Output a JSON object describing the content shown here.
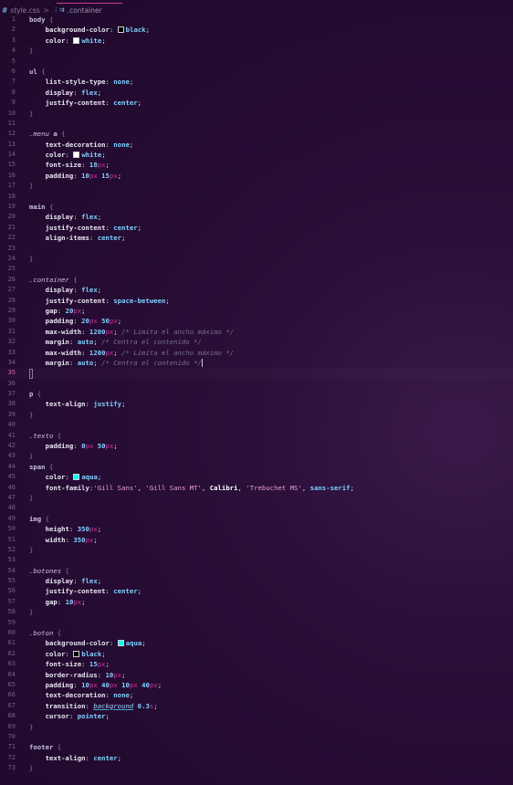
{
  "breadcrumb": {
    "file": "style.css",
    "separator": ">",
    "symbol": ".container"
  },
  "colors": {
    "background": "#240b31",
    "accent": "#d0389a",
    "value": "#7fd0ff",
    "property": "#e9e6f2",
    "comment": "#7a6e8e"
  },
  "lines": [
    {
      "n": "1",
      "t": [
        [
          "sel",
          "body"
        ],
        [
          "br",
          " {"
        ]
      ]
    },
    {
      "n": "2",
      "t": [
        [
          "in",
          "    "
        ],
        [
          "prop",
          "background-color"
        ],
        [
          "p",
          ": "
        ],
        [
          "sw",
          "#000000"
        ],
        [
          "val",
          "black"
        ],
        [
          "p",
          ";"
        ]
      ]
    },
    {
      "n": "3",
      "t": [
        [
          "in",
          "    "
        ],
        [
          "prop",
          "color"
        ],
        [
          "p",
          ": "
        ],
        [
          "sw",
          "#ffffff"
        ],
        [
          "val",
          "white"
        ],
        [
          "p",
          ";"
        ]
      ]
    },
    {
      "n": "4",
      "t": [
        [
          "br",
          "}"
        ]
      ]
    },
    {
      "n": "5",
      "t": []
    },
    {
      "n": "6",
      "t": [
        [
          "sel",
          "ul"
        ],
        [
          "br",
          " {"
        ]
      ]
    },
    {
      "n": "7",
      "t": [
        [
          "in",
          "    "
        ],
        [
          "prop",
          "list-style-type"
        ],
        [
          "p",
          ": "
        ],
        [
          "val",
          "none"
        ],
        [
          "p",
          ";"
        ]
      ]
    },
    {
      "n": "8",
      "t": [
        [
          "in",
          "    "
        ],
        [
          "prop",
          "display"
        ],
        [
          "p",
          ": "
        ],
        [
          "val",
          "flex"
        ],
        [
          "p",
          ";"
        ]
      ]
    },
    {
      "n": "9",
      "t": [
        [
          "in",
          "    "
        ],
        [
          "prop",
          "justify-content"
        ],
        [
          "p",
          ": "
        ],
        [
          "val",
          "center"
        ],
        [
          "p",
          ";"
        ]
      ]
    },
    {
      "n": "10",
      "t": [
        [
          "br",
          "}"
        ]
      ]
    },
    {
      "n": "11",
      "t": []
    },
    {
      "n": "12",
      "t": [
        [
          "seli",
          ".menu"
        ],
        [
          "sel",
          " a"
        ],
        [
          "br",
          " {"
        ]
      ]
    },
    {
      "n": "13",
      "t": [
        [
          "in",
          "    "
        ],
        [
          "prop",
          "text-decoration"
        ],
        [
          "p",
          ": "
        ],
        [
          "val",
          "none"
        ],
        [
          "p",
          ";"
        ]
      ]
    },
    {
      "n": "14",
      "t": [
        [
          "in",
          "    "
        ],
        [
          "prop",
          "color"
        ],
        [
          "p",
          ": "
        ],
        [
          "sw",
          "#ffffff"
        ],
        [
          "val",
          "white"
        ],
        [
          "p",
          ";"
        ]
      ]
    },
    {
      "n": "15",
      "t": [
        [
          "in",
          "    "
        ],
        [
          "prop",
          "font-size"
        ],
        [
          "p",
          ": "
        ],
        [
          "num",
          "18"
        ],
        [
          "unit",
          "px"
        ],
        [
          "p",
          ";"
        ]
      ]
    },
    {
      "n": "16",
      "t": [
        [
          "in",
          "    "
        ],
        [
          "prop",
          "padding"
        ],
        [
          "p",
          ": "
        ],
        [
          "num",
          "10"
        ],
        [
          "unit",
          "px"
        ],
        [
          "p",
          " "
        ],
        [
          "num",
          "15"
        ],
        [
          "unit",
          "px"
        ],
        [
          "p",
          ";"
        ]
      ]
    },
    {
      "n": "17",
      "t": [
        [
          "br",
          "}"
        ]
      ]
    },
    {
      "n": "18",
      "t": []
    },
    {
      "n": "19",
      "t": [
        [
          "sel",
          "main"
        ],
        [
          "br",
          " {"
        ]
      ]
    },
    {
      "n": "20",
      "t": [
        [
          "in",
          "    "
        ],
        [
          "prop",
          "display"
        ],
        [
          "p",
          ": "
        ],
        [
          "val",
          "flex"
        ],
        [
          "p",
          ";"
        ]
      ]
    },
    {
      "n": "21",
      "t": [
        [
          "in",
          "    "
        ],
        [
          "prop",
          "justify-content"
        ],
        [
          "p",
          ": "
        ],
        [
          "val",
          "center"
        ],
        [
          "p",
          ";"
        ]
      ]
    },
    {
      "n": "22",
      "t": [
        [
          "in",
          "    "
        ],
        [
          "prop",
          "align-items"
        ],
        [
          "p",
          ": "
        ],
        [
          "val",
          "center"
        ],
        [
          "p",
          ";"
        ]
      ]
    },
    {
      "n": "23",
      "t": []
    },
    {
      "n": "24",
      "t": [
        [
          "br",
          "}"
        ]
      ]
    },
    {
      "n": "25",
      "t": []
    },
    {
      "n": "26",
      "t": [
        [
          "seli",
          ".container"
        ],
        [
          "br",
          " {"
        ]
      ]
    },
    {
      "n": "27",
      "t": [
        [
          "in",
          "    "
        ],
        [
          "prop",
          "display"
        ],
        [
          "p",
          ": "
        ],
        [
          "val",
          "flex"
        ],
        [
          "p",
          ";"
        ]
      ]
    },
    {
      "n": "28",
      "t": [
        [
          "in",
          "    "
        ],
        [
          "prop",
          "justify-content"
        ],
        [
          "p",
          ": "
        ],
        [
          "val",
          "space-between"
        ],
        [
          "p",
          ";"
        ]
      ]
    },
    {
      "n": "29",
      "t": [
        [
          "in",
          "    "
        ],
        [
          "prop",
          "gap"
        ],
        [
          "p",
          ": "
        ],
        [
          "num",
          "20"
        ],
        [
          "unit",
          "px"
        ],
        [
          "p",
          ";"
        ]
      ]
    },
    {
      "n": "30",
      "t": [
        [
          "in",
          "    "
        ],
        [
          "prop",
          "padding"
        ],
        [
          "p",
          ": "
        ],
        [
          "num",
          "20"
        ],
        [
          "unit",
          "px"
        ],
        [
          "p",
          " "
        ],
        [
          "num",
          "50"
        ],
        [
          "unit",
          "px"
        ],
        [
          "p",
          ";"
        ]
      ]
    },
    {
      "n": "31",
      "t": [
        [
          "in",
          "    "
        ],
        [
          "prop",
          "max-width"
        ],
        [
          "p",
          ": "
        ],
        [
          "num",
          "1200"
        ],
        [
          "unit",
          "px"
        ],
        [
          "p",
          "; "
        ],
        [
          "cmt",
          "/* Limita el ancho máximo */"
        ]
      ]
    },
    {
      "n": "32",
      "t": [
        [
          "in",
          "    "
        ],
        [
          "prop",
          "margin"
        ],
        [
          "p",
          ": "
        ],
        [
          "val",
          "auto"
        ],
        [
          "p",
          "; "
        ],
        [
          "cmt",
          "/* Centra el contenido */"
        ]
      ]
    },
    {
      "n": "33",
      "t": [
        [
          "in",
          "    "
        ],
        [
          "prop",
          "max-width"
        ],
        [
          "p",
          ": "
        ],
        [
          "num",
          "1200"
        ],
        [
          "unit",
          "px"
        ],
        [
          "p",
          "; "
        ],
        [
          "cmt",
          "/* Limita el ancho máximo */"
        ]
      ]
    },
    {
      "n": "34",
      "t": [
        [
          "in",
          "    "
        ],
        [
          "prop",
          "margin"
        ],
        [
          "p",
          ": "
        ],
        [
          "val",
          "auto"
        ],
        [
          "p",
          "; "
        ],
        [
          "cmt",
          "/* Centra el contenido */"
        ],
        [
          "caret",
          ""
        ]
      ]
    },
    {
      "n": "35",
      "t": [
        [
          "box",
          ""
        ]
      ],
      "active": true
    },
    {
      "n": "36",
      "t": []
    },
    {
      "n": "37",
      "t": [
        [
          "sel",
          "p"
        ],
        [
          "br",
          " {"
        ]
      ]
    },
    {
      "n": "38",
      "t": [
        [
          "in",
          "    "
        ],
        [
          "prop",
          "text-align"
        ],
        [
          "p",
          ": "
        ],
        [
          "val",
          "justify"
        ],
        [
          "p",
          ";"
        ]
      ]
    },
    {
      "n": "39",
      "t": [
        [
          "br",
          "}"
        ]
      ]
    },
    {
      "n": "40",
      "t": []
    },
    {
      "n": "41",
      "t": [
        [
          "seli",
          ".texto"
        ],
        [
          "br",
          " {"
        ]
      ]
    },
    {
      "n": "42",
      "t": [
        [
          "in",
          "    "
        ],
        [
          "prop",
          "padding"
        ],
        [
          "p",
          ": "
        ],
        [
          "num",
          "0"
        ],
        [
          "unit",
          "px"
        ],
        [
          "p",
          " "
        ],
        [
          "num",
          "50"
        ],
        [
          "unit",
          "px"
        ],
        [
          "p",
          ";"
        ]
      ]
    },
    {
      "n": "43",
      "t": [
        [
          "br",
          "}"
        ]
      ]
    },
    {
      "n": "44",
      "t": [
        [
          "sel",
          "span"
        ],
        [
          "br",
          " {"
        ]
      ]
    },
    {
      "n": "45",
      "t": [
        [
          "in",
          "    "
        ],
        [
          "prop",
          "color"
        ],
        [
          "p",
          ": "
        ],
        [
          "sw",
          "#00ffff"
        ],
        [
          "val",
          "aqua"
        ],
        [
          "p",
          ";"
        ]
      ]
    },
    {
      "n": "46",
      "t": [
        [
          "in",
          "    "
        ],
        [
          "prop",
          "font-family"
        ],
        [
          "p",
          ":"
        ],
        [
          "str",
          "'Gill Sans'"
        ],
        [
          "p",
          ", "
        ],
        [
          "str",
          "'Gill Sans MT'"
        ],
        [
          "p",
          ", "
        ],
        [
          "fn",
          "Calibri"
        ],
        [
          "p",
          ", "
        ],
        [
          "str",
          "'Trebuchet MS'"
        ],
        [
          "p",
          ", "
        ],
        [
          "val",
          "sans-serif"
        ],
        [
          "p",
          ";"
        ]
      ]
    },
    {
      "n": "47",
      "t": [
        [
          "br",
          "}"
        ]
      ]
    },
    {
      "n": "48",
      "t": []
    },
    {
      "n": "49",
      "t": [
        [
          "sel",
          "img"
        ],
        [
          "br",
          " {"
        ]
      ]
    },
    {
      "n": "50",
      "t": [
        [
          "in",
          "    "
        ],
        [
          "prop",
          "height"
        ],
        [
          "p",
          ": "
        ],
        [
          "num",
          "350"
        ],
        [
          "unit",
          "px"
        ],
        [
          "p",
          ";"
        ]
      ]
    },
    {
      "n": "51",
      "t": [
        [
          "in",
          "    "
        ],
        [
          "prop",
          "width"
        ],
        [
          "p",
          ": "
        ],
        [
          "num",
          "350"
        ],
        [
          "unit",
          "px"
        ],
        [
          "p",
          ";"
        ]
      ]
    },
    {
      "n": "52",
      "t": [
        [
          "br",
          "}"
        ]
      ]
    },
    {
      "n": "53",
      "t": []
    },
    {
      "n": "54",
      "t": [
        [
          "seli",
          ".botones"
        ],
        [
          "br",
          " {"
        ]
      ]
    },
    {
      "n": "55",
      "t": [
        [
          "in",
          "    "
        ],
        [
          "prop",
          "display"
        ],
        [
          "p",
          ": "
        ],
        [
          "val",
          "flex"
        ],
        [
          "p",
          ";"
        ]
      ]
    },
    {
      "n": "56",
      "t": [
        [
          "in",
          "    "
        ],
        [
          "prop",
          "justify-content"
        ],
        [
          "p",
          ": "
        ],
        [
          "val",
          "center"
        ],
        [
          "p",
          ";"
        ]
      ]
    },
    {
      "n": "57",
      "t": [
        [
          "in",
          "    "
        ],
        [
          "prop",
          "gap"
        ],
        [
          "p",
          ": "
        ],
        [
          "num",
          "10"
        ],
        [
          "unit",
          "px"
        ],
        [
          "p",
          ";"
        ]
      ]
    },
    {
      "n": "58",
      "t": [
        [
          "br",
          "}"
        ]
      ]
    },
    {
      "n": "59",
      "t": []
    },
    {
      "n": "60",
      "t": [
        [
          "seli",
          ".boton"
        ],
        [
          "br",
          " {"
        ]
      ]
    },
    {
      "n": "61",
      "t": [
        [
          "in",
          "    "
        ],
        [
          "prop",
          "background-color"
        ],
        [
          "p",
          ": "
        ],
        [
          "sw",
          "#00ffff"
        ],
        [
          "val",
          "aqua"
        ],
        [
          "p",
          ";"
        ]
      ]
    },
    {
      "n": "62",
      "t": [
        [
          "in",
          "    "
        ],
        [
          "prop",
          "color"
        ],
        [
          "p",
          ": "
        ],
        [
          "sw",
          "#000000"
        ],
        [
          "val",
          "black"
        ],
        [
          "p",
          ";"
        ]
      ]
    },
    {
      "n": "63",
      "t": [
        [
          "in",
          "    "
        ],
        [
          "prop",
          "font-size"
        ],
        [
          "p",
          ": "
        ],
        [
          "num",
          "15"
        ],
        [
          "unit",
          "px"
        ],
        [
          "p",
          ";"
        ]
      ]
    },
    {
      "n": "64",
      "t": [
        [
          "in",
          "    "
        ],
        [
          "prop",
          "border-radius"
        ],
        [
          "p",
          ": "
        ],
        [
          "num",
          "10"
        ],
        [
          "unit",
          "px"
        ],
        [
          "p",
          ";"
        ]
      ]
    },
    {
      "n": "65",
      "t": [
        [
          "in",
          "    "
        ],
        [
          "prop",
          "padding"
        ],
        [
          "p",
          ": "
        ],
        [
          "num",
          "10"
        ],
        [
          "unit",
          "px"
        ],
        [
          "p",
          " "
        ],
        [
          "num",
          "40"
        ],
        [
          "unit",
          "px"
        ],
        [
          "p",
          " "
        ],
        [
          "num",
          "10"
        ],
        [
          "unit",
          "px"
        ],
        [
          "p",
          " "
        ],
        [
          "num",
          "40"
        ],
        [
          "unit",
          "px"
        ],
        [
          "p",
          ";"
        ]
      ]
    },
    {
      "n": "66",
      "t": [
        [
          "in",
          "    "
        ],
        [
          "prop",
          "text-decoration"
        ],
        [
          "p",
          ": "
        ],
        [
          "val",
          "none"
        ],
        [
          "p",
          ";"
        ]
      ]
    },
    {
      "n": "67",
      "t": [
        [
          "in",
          "    "
        ],
        [
          "prop",
          "transition"
        ],
        [
          "p",
          ": "
        ],
        [
          "u",
          "background"
        ],
        [
          "p",
          " "
        ],
        [
          "num",
          "0.3"
        ],
        [
          "unit",
          "s"
        ],
        [
          "p",
          ";"
        ]
      ]
    },
    {
      "n": "68",
      "t": [
        [
          "in",
          "    "
        ],
        [
          "prop",
          "cursor"
        ],
        [
          "p",
          ": "
        ],
        [
          "val",
          "pointer"
        ],
        [
          "p",
          ";"
        ]
      ]
    },
    {
      "n": "69",
      "t": [
        [
          "br",
          "}"
        ]
      ]
    },
    {
      "n": "70",
      "t": []
    },
    {
      "n": "71",
      "t": [
        [
          "sel",
          "footer"
        ],
        [
          "br",
          " {"
        ]
      ]
    },
    {
      "n": "72",
      "t": [
        [
          "in",
          "    "
        ],
        [
          "prop",
          "text-align"
        ],
        [
          "p",
          ": "
        ],
        [
          "val",
          "center"
        ],
        [
          "p",
          ";"
        ]
      ]
    },
    {
      "n": "73",
      "t": [
        [
          "br",
          "}"
        ]
      ]
    }
  ]
}
